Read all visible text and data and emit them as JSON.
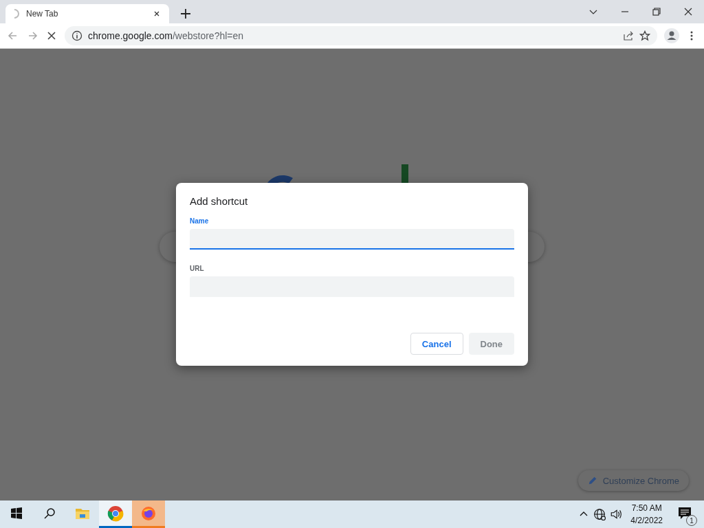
{
  "tabs": [
    {
      "title": "New Tab",
      "selected": true,
      "loading": true
    }
  ],
  "address": {
    "host": "chrome.google.com",
    "path": "/webstore?hl=en",
    "loading": true
  },
  "dialog": {
    "title": "Add shortcut",
    "fields": [
      {
        "label": "Name",
        "focused": true
      },
      {
        "label": "URL",
        "focused": false
      }
    ],
    "buttons": [
      {
        "label": "Cancel",
        "kind": "secondary",
        "disabled": false
      },
      {
        "label": "Done",
        "kind": "primary",
        "disabled": true
      }
    ]
  },
  "customize_button": {
    "label": "Customize Chrome"
  },
  "taskbar": {
    "apps": [
      {
        "kind": "folder",
        "running": false,
        "selected": false
      },
      {
        "kind": "chrome",
        "running": true,
        "selected": false
      },
      {
        "kind": "firefox",
        "running": true,
        "selected": true
      }
    ],
    "time": "7:50 AM",
    "date": "4/2/2022",
    "notifications": "1"
  }
}
